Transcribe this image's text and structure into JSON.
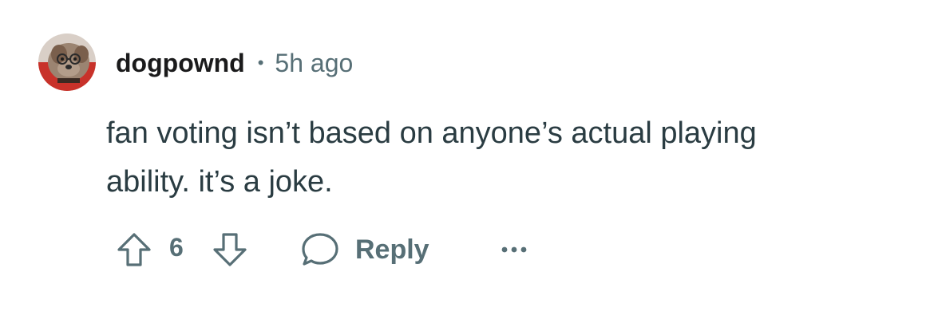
{
  "comment": {
    "username": "dogpownd",
    "separator": "•",
    "timestamp": "5h ago",
    "body_lines": [
      "fan voting isn’t based on anyone’s actual playing",
      "ability. it’s a joke."
    ],
    "vote_count": "6",
    "reply_label": "Reply"
  },
  "icons": {
    "avatar": "dog-with-glasses-avatar",
    "upvote": "arrow-up-outline-icon",
    "downvote": "arrow-down-outline-icon",
    "reply": "speech-bubble-icon",
    "more": "ellipsis-icon"
  },
  "colors": {
    "username": "#1a1a1b",
    "meta": "#576f76",
    "body": "#2a3c42",
    "background": "#ffffff"
  }
}
